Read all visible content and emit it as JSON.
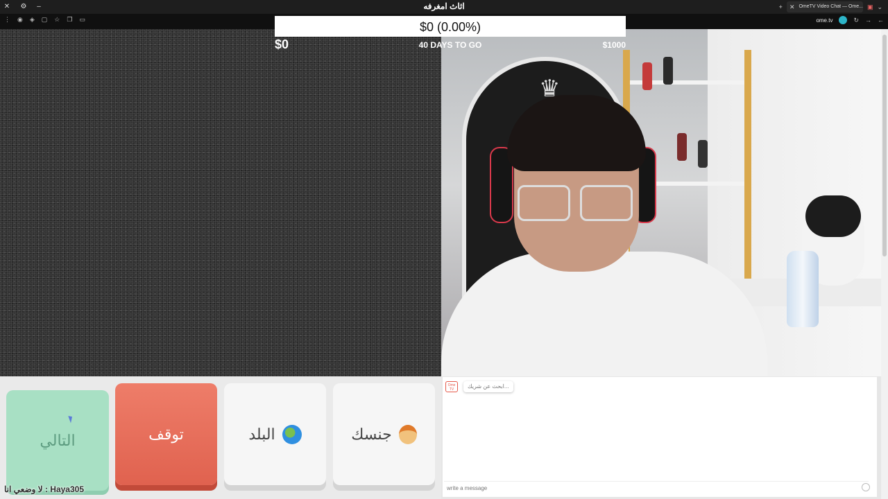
{
  "window": {
    "title": "اثاث امغرفه",
    "tab_title": "OmeTV Video Chat — Ome..."
  },
  "browser": {
    "address": "ome.tv"
  },
  "overlay": {
    "progress_text": "$0 (0.00%)",
    "current_amount": "$0",
    "days_text": "40 DAYS TO GO",
    "goal_amount": "$1000",
    "progress_fraction": 0
  },
  "controls": {
    "next_label": "التالي",
    "stop_label": "توقف",
    "country_label": "البلد",
    "gender_label": "جنسك",
    "watermark": "Haya305 : لا وضعي انا"
  },
  "chat": {
    "logo_text": "Ome TV",
    "status_message": "...ابحث عن شريك",
    "input_placeholder": "write a message"
  },
  "colors": {
    "next_bg": "#a8e0c4",
    "stop_bg": "#e0624f",
    "accent": "#e5594a"
  },
  "icons": {
    "country_icon": "globe-icon",
    "gender_icon": "face-icon"
  }
}
